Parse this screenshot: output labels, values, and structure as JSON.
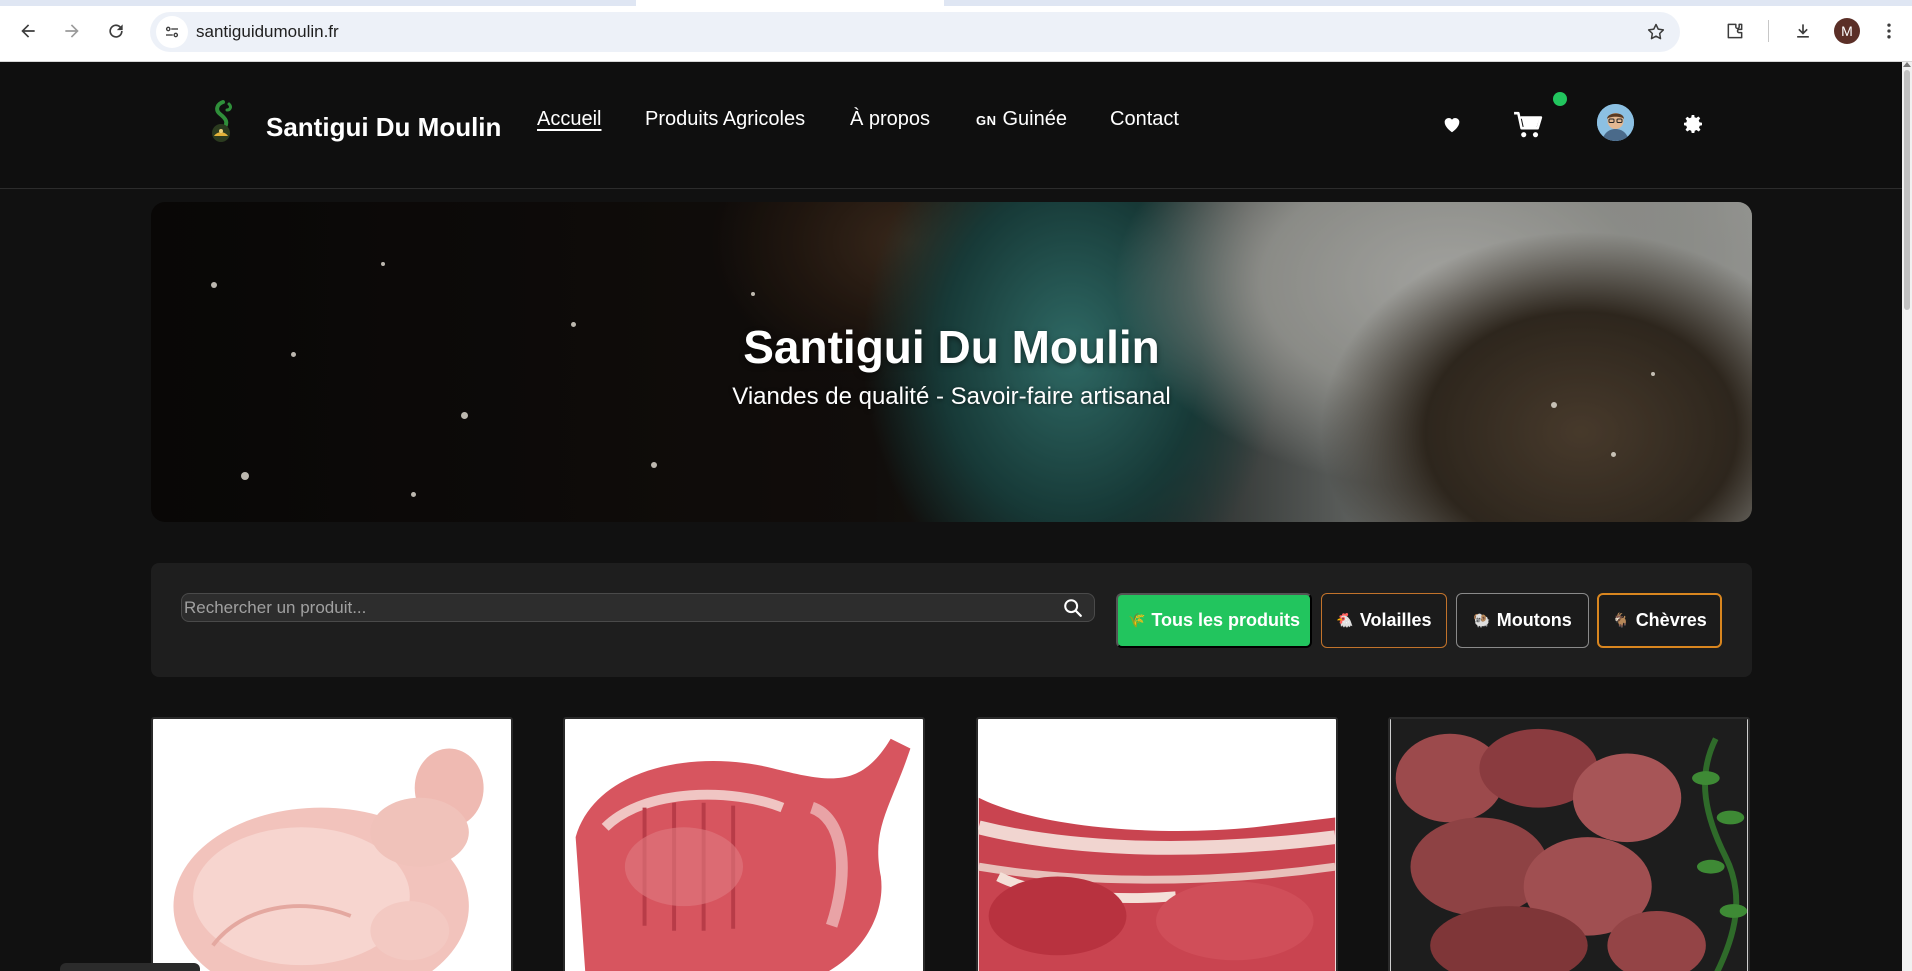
{
  "browser": {
    "url": "santiguidumoulin.fr",
    "profile_initial": "M"
  },
  "header": {
    "brand": "Santigui Du Moulin",
    "nav": [
      {
        "label": "Accueil",
        "active": true
      },
      {
        "label": "Produits Agricoles",
        "active": false
      },
      {
        "label": "À propos",
        "active": false
      },
      {
        "flag": "GN",
        "label": "Guinée",
        "active": false
      },
      {
        "label": "Contact",
        "active": false
      }
    ],
    "icons": [
      "heart-icon",
      "cart-icon",
      "user-avatar",
      "settings-gear-icon"
    ],
    "cart_status_color": "#22c55e"
  },
  "hero": {
    "title": "Santigui Du Moulin",
    "subtitle": "Viandes de qualité - Savoir-faire artisanal"
  },
  "filters": {
    "search_placeholder": "Rechercher un produit...",
    "categories": [
      {
        "emoji": "🌾",
        "label": "Tous les produits",
        "active": true
      },
      {
        "emoji": "🐔",
        "label": "Volailles",
        "active": false
      },
      {
        "emoji": "🐏",
        "label": "Moutons",
        "active": false
      },
      {
        "emoji": "🐐",
        "label": "Chèvres",
        "active": false
      }
    ],
    "active_color": "#22c55e"
  },
  "products": [
    {
      "image": "whole-chicken"
    },
    {
      "image": "lamb-carcass"
    },
    {
      "image": "lamb-rack"
    },
    {
      "image": "goat-meat-pieces"
    }
  ]
}
